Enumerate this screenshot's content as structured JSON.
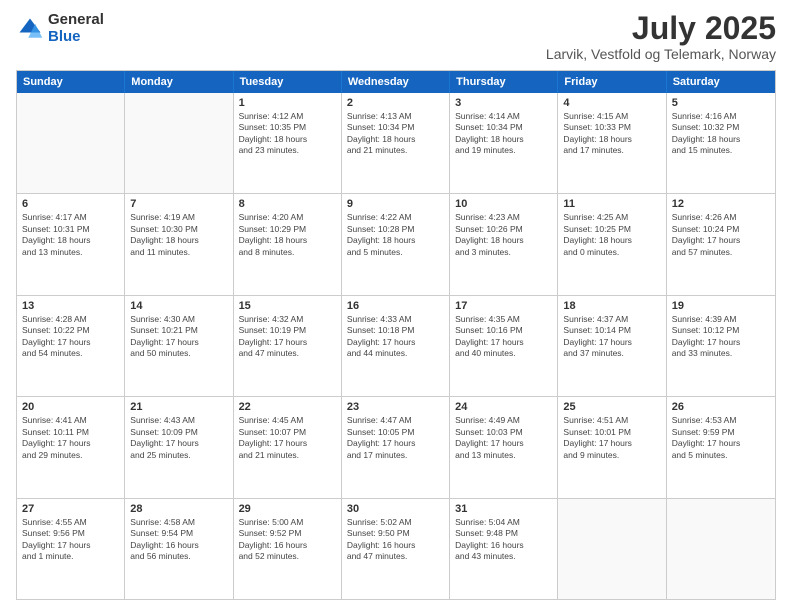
{
  "header": {
    "logo_general": "General",
    "logo_blue": "Blue",
    "title": "July 2025",
    "location": "Larvik, Vestfold og Telemark, Norway"
  },
  "weekdays": [
    "Sunday",
    "Monday",
    "Tuesday",
    "Wednesday",
    "Thursday",
    "Friday",
    "Saturday"
  ],
  "rows": [
    [
      {
        "day": "",
        "info": ""
      },
      {
        "day": "",
        "info": ""
      },
      {
        "day": "1",
        "info": "Sunrise: 4:12 AM\nSunset: 10:35 PM\nDaylight: 18 hours\nand 23 minutes."
      },
      {
        "day": "2",
        "info": "Sunrise: 4:13 AM\nSunset: 10:34 PM\nDaylight: 18 hours\nand 21 minutes."
      },
      {
        "day": "3",
        "info": "Sunrise: 4:14 AM\nSunset: 10:34 PM\nDaylight: 18 hours\nand 19 minutes."
      },
      {
        "day": "4",
        "info": "Sunrise: 4:15 AM\nSunset: 10:33 PM\nDaylight: 18 hours\nand 17 minutes."
      },
      {
        "day": "5",
        "info": "Sunrise: 4:16 AM\nSunset: 10:32 PM\nDaylight: 18 hours\nand 15 minutes."
      }
    ],
    [
      {
        "day": "6",
        "info": "Sunrise: 4:17 AM\nSunset: 10:31 PM\nDaylight: 18 hours\nand 13 minutes."
      },
      {
        "day": "7",
        "info": "Sunrise: 4:19 AM\nSunset: 10:30 PM\nDaylight: 18 hours\nand 11 minutes."
      },
      {
        "day": "8",
        "info": "Sunrise: 4:20 AM\nSunset: 10:29 PM\nDaylight: 18 hours\nand 8 minutes."
      },
      {
        "day": "9",
        "info": "Sunrise: 4:22 AM\nSunset: 10:28 PM\nDaylight: 18 hours\nand 5 minutes."
      },
      {
        "day": "10",
        "info": "Sunrise: 4:23 AM\nSunset: 10:26 PM\nDaylight: 18 hours\nand 3 minutes."
      },
      {
        "day": "11",
        "info": "Sunrise: 4:25 AM\nSunset: 10:25 PM\nDaylight: 18 hours\nand 0 minutes."
      },
      {
        "day": "12",
        "info": "Sunrise: 4:26 AM\nSunset: 10:24 PM\nDaylight: 17 hours\nand 57 minutes."
      }
    ],
    [
      {
        "day": "13",
        "info": "Sunrise: 4:28 AM\nSunset: 10:22 PM\nDaylight: 17 hours\nand 54 minutes."
      },
      {
        "day": "14",
        "info": "Sunrise: 4:30 AM\nSunset: 10:21 PM\nDaylight: 17 hours\nand 50 minutes."
      },
      {
        "day": "15",
        "info": "Sunrise: 4:32 AM\nSunset: 10:19 PM\nDaylight: 17 hours\nand 47 minutes."
      },
      {
        "day": "16",
        "info": "Sunrise: 4:33 AM\nSunset: 10:18 PM\nDaylight: 17 hours\nand 44 minutes."
      },
      {
        "day": "17",
        "info": "Sunrise: 4:35 AM\nSunset: 10:16 PM\nDaylight: 17 hours\nand 40 minutes."
      },
      {
        "day": "18",
        "info": "Sunrise: 4:37 AM\nSunset: 10:14 PM\nDaylight: 17 hours\nand 37 minutes."
      },
      {
        "day": "19",
        "info": "Sunrise: 4:39 AM\nSunset: 10:12 PM\nDaylight: 17 hours\nand 33 minutes."
      }
    ],
    [
      {
        "day": "20",
        "info": "Sunrise: 4:41 AM\nSunset: 10:11 PM\nDaylight: 17 hours\nand 29 minutes."
      },
      {
        "day": "21",
        "info": "Sunrise: 4:43 AM\nSunset: 10:09 PM\nDaylight: 17 hours\nand 25 minutes."
      },
      {
        "day": "22",
        "info": "Sunrise: 4:45 AM\nSunset: 10:07 PM\nDaylight: 17 hours\nand 21 minutes."
      },
      {
        "day": "23",
        "info": "Sunrise: 4:47 AM\nSunset: 10:05 PM\nDaylight: 17 hours\nand 17 minutes."
      },
      {
        "day": "24",
        "info": "Sunrise: 4:49 AM\nSunset: 10:03 PM\nDaylight: 17 hours\nand 13 minutes."
      },
      {
        "day": "25",
        "info": "Sunrise: 4:51 AM\nSunset: 10:01 PM\nDaylight: 17 hours\nand 9 minutes."
      },
      {
        "day": "26",
        "info": "Sunrise: 4:53 AM\nSunset: 9:59 PM\nDaylight: 17 hours\nand 5 minutes."
      }
    ],
    [
      {
        "day": "27",
        "info": "Sunrise: 4:55 AM\nSunset: 9:56 PM\nDaylight: 17 hours\nand 1 minute."
      },
      {
        "day": "28",
        "info": "Sunrise: 4:58 AM\nSunset: 9:54 PM\nDaylight: 16 hours\nand 56 minutes."
      },
      {
        "day": "29",
        "info": "Sunrise: 5:00 AM\nSunset: 9:52 PM\nDaylight: 16 hours\nand 52 minutes."
      },
      {
        "day": "30",
        "info": "Sunrise: 5:02 AM\nSunset: 9:50 PM\nDaylight: 16 hours\nand 47 minutes."
      },
      {
        "day": "31",
        "info": "Sunrise: 5:04 AM\nSunset: 9:48 PM\nDaylight: 16 hours\nand 43 minutes."
      },
      {
        "day": "",
        "info": ""
      },
      {
        "day": "",
        "info": ""
      }
    ]
  ]
}
